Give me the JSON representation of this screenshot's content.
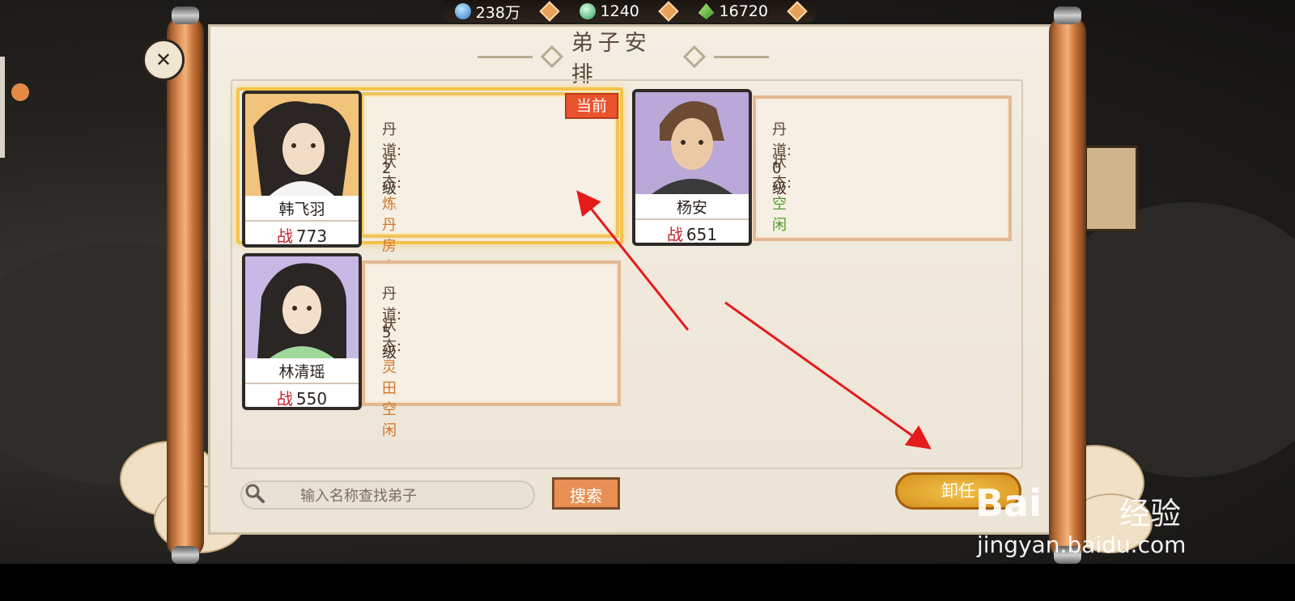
{
  "resources": [
    {
      "icon": "spirit-stone-icon",
      "value": "238万"
    },
    {
      "icon": "jade-icon",
      "value": "1240"
    },
    {
      "icon": "herb-icon",
      "value": "16720"
    }
  ],
  "panel": {
    "title": "弟子安排"
  },
  "disciples": [
    {
      "name": "韩飞羽",
      "power_label": "战",
      "power": "773",
      "dao_label": "丹道:",
      "dao_value": "2级",
      "status_label": "状态:",
      "status_value": "炼丹房空闲",
      "status_color": "#d0772d",
      "badge": "当前",
      "selected": true
    },
    {
      "name": "杨安",
      "power_label": "战",
      "power": "651",
      "dao_label": "丹道:",
      "dao_value": "0级",
      "status_label": "状态:",
      "status_value": "空闲",
      "status_color": "#4e9a2c",
      "selected": false
    },
    {
      "name": "林清瑶",
      "power_label": "战",
      "power": "550",
      "dao_label": "丹道:",
      "dao_value": "5级",
      "status_label": "状态:",
      "status_value": "灵田空闲",
      "status_color": "#d0772d",
      "selected": false
    }
  ],
  "search": {
    "placeholder": "输入名称查找弟子",
    "button_label": "搜索"
  },
  "dismiss_label": "卸任",
  "watermark": {
    "logo": "Bai",
    "text": "经验",
    "url": "jingyan.baidu.com"
  },
  "colors": {
    "accent_gold": "#f4c349",
    "button_orange": "#e88f54",
    "annotation_red": "#e51b1b"
  }
}
